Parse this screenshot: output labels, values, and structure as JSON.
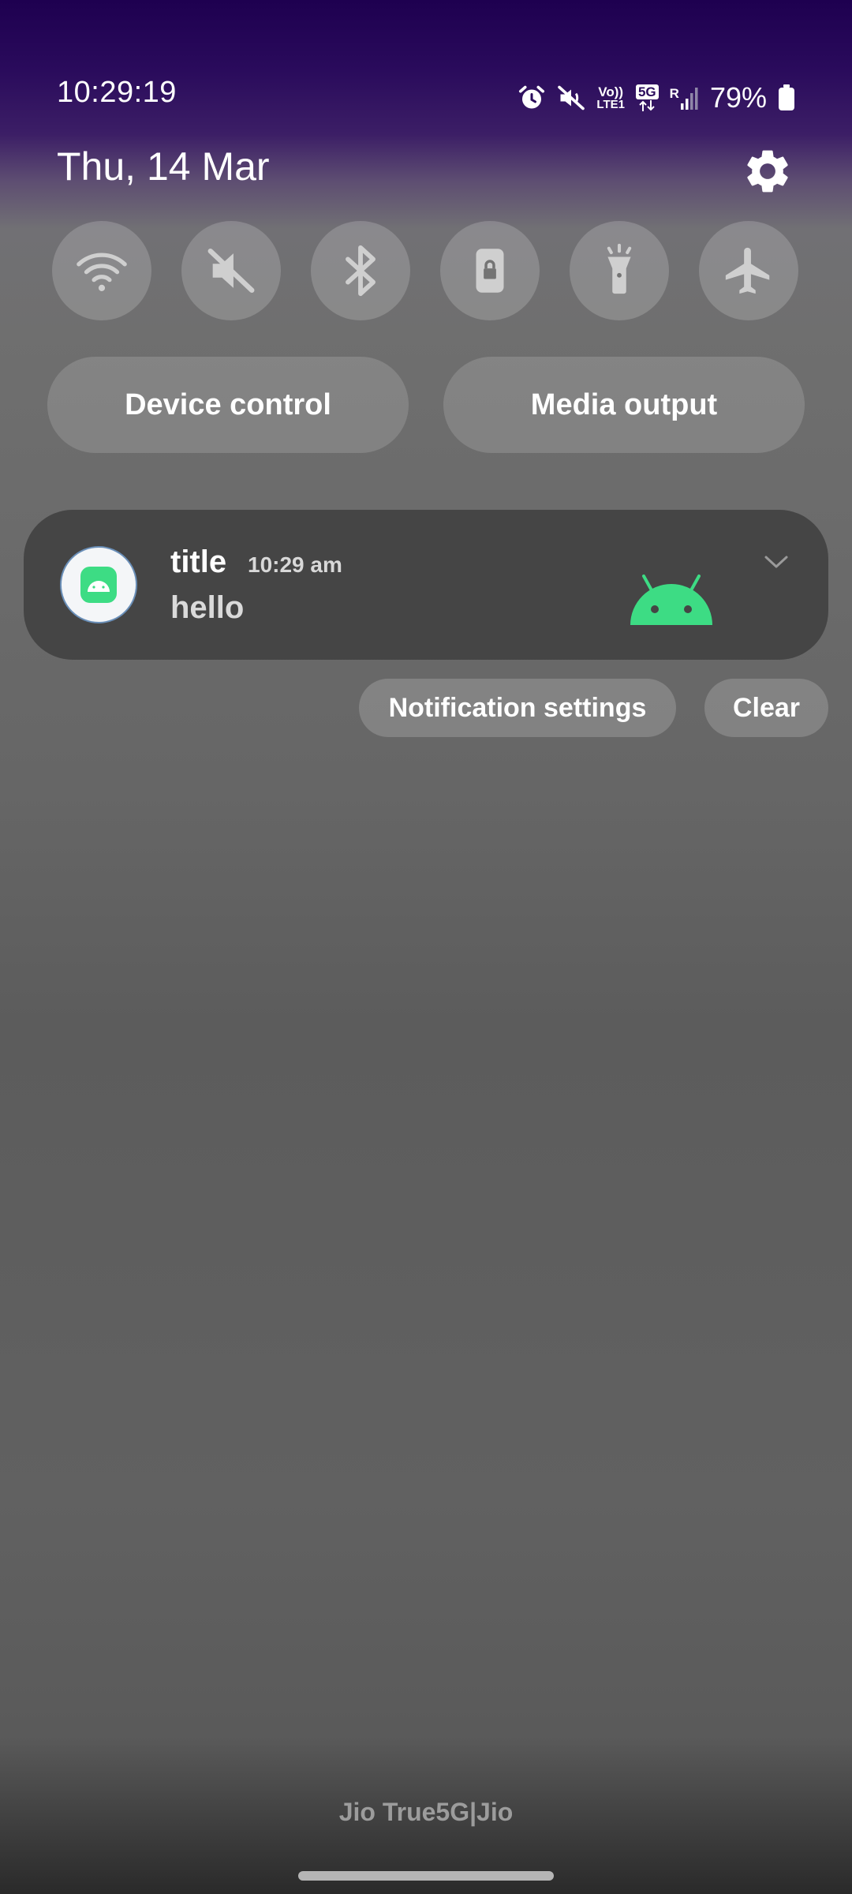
{
  "status_bar": {
    "time": "10:29:19",
    "network_vo": "Vo))",
    "network_lte": "LTE1",
    "network_5g": "5G",
    "roaming": "R",
    "battery_percent": "79%",
    "icons": [
      "alarm-icon",
      "mute-icon",
      "volte-icon",
      "5g-icon",
      "signal-icon",
      "battery-icon"
    ]
  },
  "header": {
    "date": "Thu, 14 Mar",
    "settings_icon": "gear-icon"
  },
  "quick_settings": {
    "tiles": [
      {
        "name": "wifi",
        "icon": "wifi-icon"
      },
      {
        "name": "sound",
        "icon": "mute-icon"
      },
      {
        "name": "bluetooth",
        "icon": "bluetooth-icon"
      },
      {
        "name": "rotation-lock",
        "icon": "lock-icon"
      },
      {
        "name": "flashlight",
        "icon": "flashlight-icon"
      },
      {
        "name": "airplane-mode",
        "icon": "airplane-icon"
      }
    ],
    "device_control_label": "Device control",
    "media_output_label": "Media output"
  },
  "notification": {
    "title": "title",
    "time": "10:29 am",
    "body": "hello",
    "app_icon": "android-app-icon",
    "accent_color": "#3ddc84"
  },
  "notification_actions": {
    "settings_label": "Notification settings",
    "clear_label": "Clear"
  },
  "footer": {
    "carrier": "Jio True5G|Jio"
  }
}
